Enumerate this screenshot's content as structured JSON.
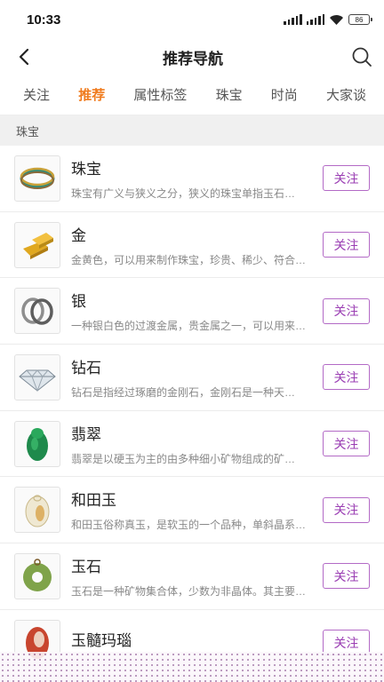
{
  "status": {
    "time": "10:33",
    "battery": "86"
  },
  "nav": {
    "title": "推荐导航"
  },
  "tabs": [
    {
      "label": "关注",
      "active": false
    },
    {
      "label": "推荐",
      "active": true
    },
    {
      "label": "属性标签",
      "active": false
    },
    {
      "label": "珠宝",
      "active": false
    },
    {
      "label": "时尚",
      "active": false
    },
    {
      "label": "大家谈",
      "active": false
    }
  ],
  "section": {
    "title": "珠宝"
  },
  "items": [
    {
      "title": "珠宝",
      "desc": "珠宝有广义与狭义之分，狭义的珠宝单指玉石…",
      "button": "关注",
      "icon": "bracelet-image"
    },
    {
      "title": "金",
      "desc": "金黄色，可以用来制作珠宝，珍贵、稀少、符合…",
      "button": "关注",
      "icon": "gold-bars-image"
    },
    {
      "title": "银",
      "desc": "一种银白色的过渡金属，贵金属之一，可以用来…",
      "button": "关注",
      "icon": "silver-rings-image"
    },
    {
      "title": "钻石",
      "desc": "钻石是指经过琢磨的金刚石，金刚石是一种天…",
      "button": "关注",
      "icon": "diamond-image"
    },
    {
      "title": "翡翠",
      "desc": "翡翠是以硬玉为主的由多种细小矿物组成的矿…",
      "button": "关注",
      "icon": "jade-carving-image"
    },
    {
      "title": "和田玉",
      "desc": "和田玉俗称真玉，是软玉的一个品种，单斜晶系…",
      "button": "关注",
      "icon": "hetian-jade-image"
    },
    {
      "title": "玉石",
      "desc": "玉石是一种矿物集合体，少数为非晶体。其主要…",
      "button": "关注",
      "icon": "jade-disc-image"
    },
    {
      "title": "玉髓玛瑙",
      "desc": "",
      "button": "关注",
      "icon": "agate-image"
    }
  ]
}
